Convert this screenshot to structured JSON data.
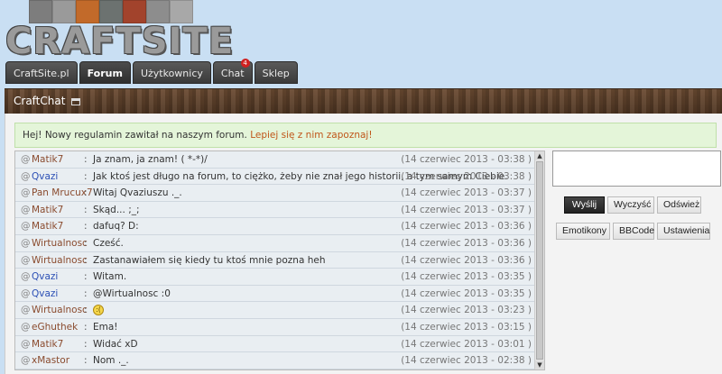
{
  "logo": {
    "text": "CRAFTSITE"
  },
  "nav": [
    {
      "label": "CraftSite.pl"
    },
    {
      "label": "Forum",
      "active": true
    },
    {
      "label": "Użytkownicy"
    },
    {
      "label": "Chat",
      "badge": "4"
    },
    {
      "label": "Sklep"
    }
  ],
  "chat": {
    "title": "CraftChat",
    "notice_text": "Hej! Nowy regulamin zawitał na naszym forum. ",
    "notice_link": "Lepiej się z nim zapoznaj!",
    "messages": [
      {
        "user": "Matik7",
        "text": "Ja znam, ja znam! ( *-*)/",
        "time": "(14 czerwiec 2013 - 03:38 )",
        "blue": false
      },
      {
        "user": "Qvazi",
        "text": "Jak ktoś jest długo na forum, to ciężko, żeby nie znał jego historii, a tym samym Ciebie.",
        "time": "(14 czerwiec 2013 - 03:38 )",
        "blue": true
      },
      {
        "user": "Pan Mrucux7",
        "text": "Witaj Qvaziuszu ._.",
        "time": "(14 czerwiec 2013 - 03:37 )",
        "blue": false
      },
      {
        "user": "Matik7",
        "text": "Skąd... ;_;",
        "time": "(14 czerwiec 2013 - 03:37 )",
        "blue": false
      },
      {
        "user": "Matik7",
        "text": "dafuq? D:",
        "time": "(14 czerwiec 2013 - 03:36 )",
        "blue": false
      },
      {
        "user": "Wirtualnosc",
        "text": "Cześć.",
        "time": "(14 czerwiec 2013 - 03:36 )",
        "blue": false
      },
      {
        "user": "Wirtualnosc",
        "text": "Zastanawiałem się kiedy tu ktoś mnie pozna heh",
        "time": "(14 czerwiec 2013 - 03:36 )",
        "blue": false
      },
      {
        "user": "Qvazi",
        "text": "Witam.",
        "time": "(14 czerwiec 2013 - 03:35 )",
        "blue": true
      },
      {
        "user": "Qvazi",
        "text": "@Wirtualnosc :0",
        "time": "(14 czerwiec 2013 - 03:35 )",
        "blue": true
      },
      {
        "user": "Wirtualnosc",
        "text": "",
        "time": "(14 czerwiec 2013 - 03:23 )",
        "blue": false,
        "emoticon": true
      },
      {
        "user": "eGhuthek",
        "text": "Ema!",
        "time": "(14 czerwiec 2013 - 03:15 )",
        "blue": false
      },
      {
        "user": "Matik7",
        "text": "Widać xD",
        "time": "(14 czerwiec 2013 - 03:01 )",
        "blue": false
      },
      {
        "user": "xMastor",
        "text": "Nom ._.",
        "time": "(14 czerwiec 2013 - 02:38 )",
        "blue": false
      }
    ],
    "input_value": "",
    "buttons": {
      "send": "Wyślij",
      "clear": "Wyczyść",
      "refresh": "Odśwież",
      "emoticons": "Emotikony",
      "bbcode": "BBCode",
      "settings": "Ustawienia"
    }
  },
  "colors": {
    "header_bg": "#c9dff3",
    "username": "#8a4b2e",
    "username_blue": "#2b4fb5",
    "notice_bg": "#e4f5d9"
  }
}
